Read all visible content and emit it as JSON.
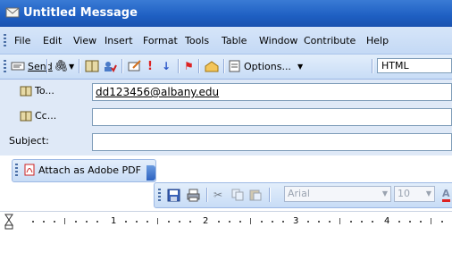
{
  "window": {
    "title": "Untitled Message"
  },
  "menubar": {
    "items": [
      {
        "label": "File"
      },
      {
        "label": "Edit"
      },
      {
        "label": "View"
      },
      {
        "label": "Insert"
      },
      {
        "label": "Format"
      },
      {
        "label": "Tools"
      },
      {
        "label": "Table"
      },
      {
        "label": "Window"
      },
      {
        "label": "Contribute"
      },
      {
        "label": "Help"
      }
    ]
  },
  "toolbar": {
    "send_label": "Send",
    "options_label": "Options...",
    "format_value": "HTML"
  },
  "header": {
    "to_label": "To...",
    "to_value": "dd123456@albany.edu",
    "cc_label": "Cc...",
    "cc_value": "",
    "subject_label": "Subject:",
    "subject_value": ""
  },
  "pdf": {
    "label": "Attach as Adobe PDF"
  },
  "formatting": {
    "font": "Arial",
    "size": "10"
  },
  "ruler": {
    "numbers": [
      "1",
      "2",
      "3",
      "4"
    ]
  },
  "colors": {
    "titlebar": "#1e5fc2",
    "panel": "#dfe9f7",
    "accent_red": "#d22"
  }
}
